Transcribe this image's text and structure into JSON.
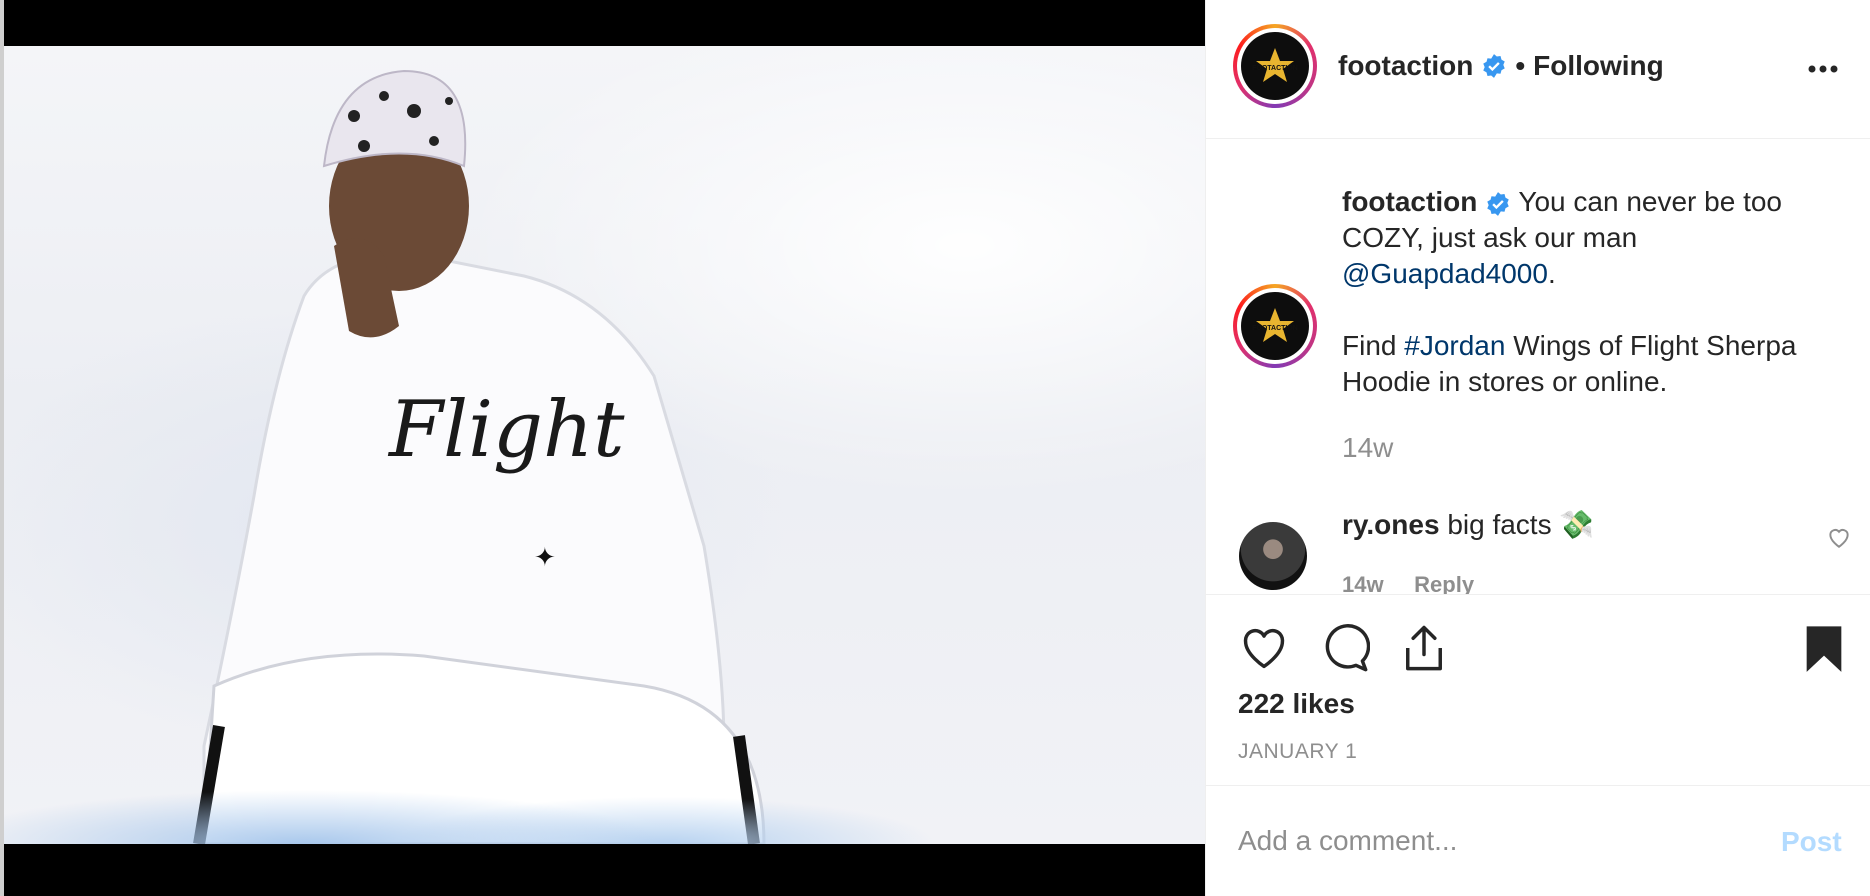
{
  "colors": {
    "text": "#262626",
    "muted": "#8e8e8e",
    "link": "#00376b",
    "verified": "#3897f0",
    "post_disabled": "#b3dbff"
  },
  "post": {
    "image_alt": "Model in white Jordan Flight sherpa hoodie sitting on a white fur backdrop"
  },
  "header": {
    "username": "footaction",
    "separator": "•",
    "follow_status": "Following",
    "more_icon": "more-horizontal-icon",
    "logo_text": "FOOTACTION"
  },
  "caption": {
    "username": "footaction",
    "text_1": "You can never be too COZY, just ask our man",
    "mention": "@Guapdad4000",
    "text_2": ".",
    "text_3": "Find",
    "hashtag": "#Jordan",
    "text_4": "Wings of Flight Sherpa Hoodie in stores or online.",
    "time": "14w"
  },
  "comments": [
    {
      "username": "ry.ones",
      "text": "big facts 💸",
      "time": "14w",
      "reply_label": "Reply"
    }
  ],
  "actions": {
    "like_icon": "heart-icon",
    "comment_icon": "comment-icon",
    "share_icon": "share-icon",
    "save_icon": "bookmark-icon"
  },
  "likes": "222 likes",
  "date": "JANUARY 1",
  "add_comment": {
    "placeholder": "Add a comment...",
    "post_label": "Post"
  }
}
